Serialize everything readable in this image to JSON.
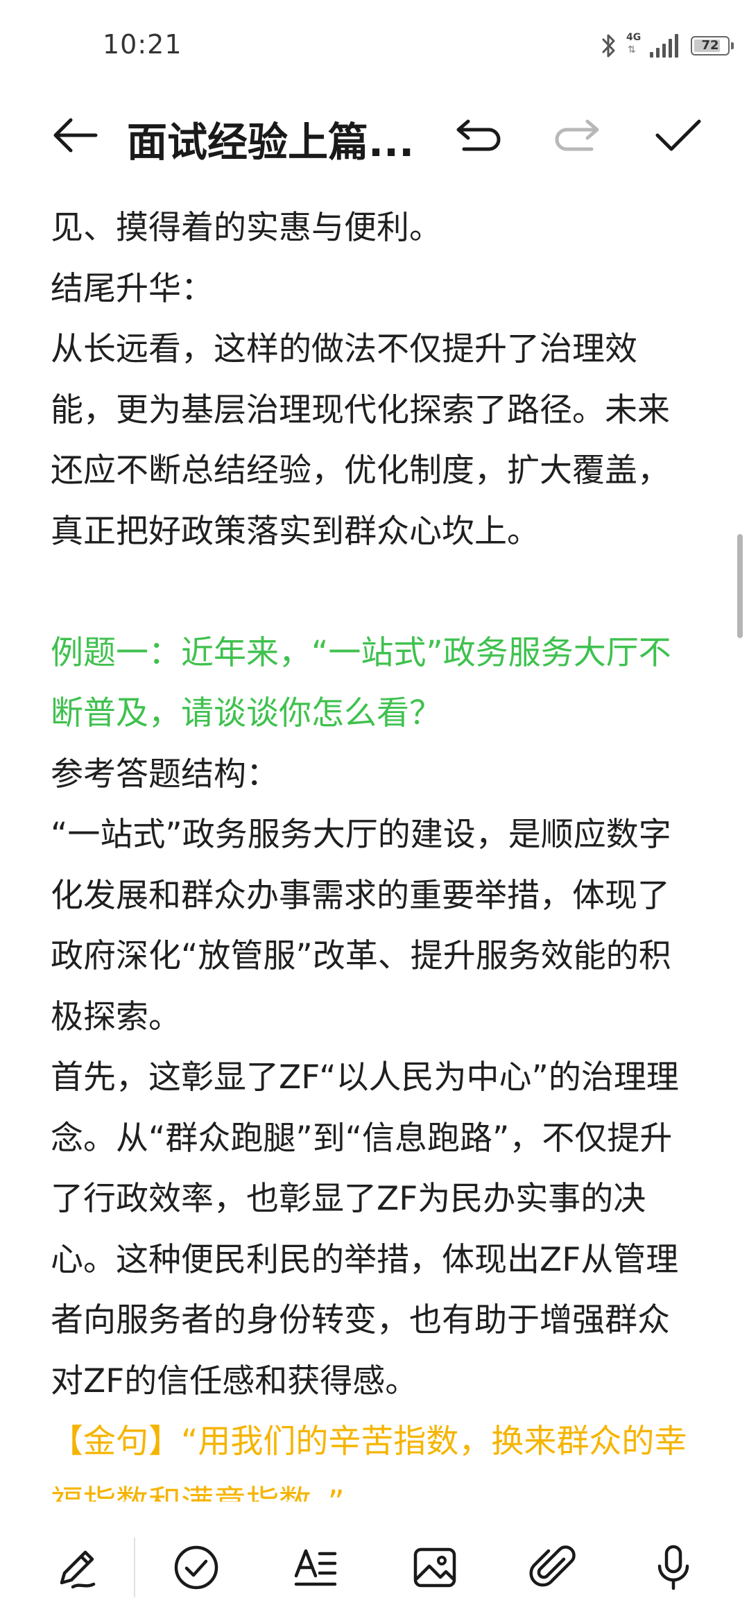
{
  "status_bar": {
    "time": "10:21",
    "network_label": "4G",
    "battery_percent": "72",
    "icons": [
      "bluetooth-icon",
      "network-4g-icon",
      "signal-strength-icon",
      "battery-icon"
    ]
  },
  "toolbar": {
    "title": "面试经验上篇...",
    "icons": [
      "back-arrow-icon",
      "undo-icon",
      "redo-icon",
      "checkmark-icon"
    ]
  },
  "content": {
    "lines": [
      "见、摸得着的实惠与便利。",
      "结尾升华：",
      "从长远看，这样的做法不仅提升了治理效",
      "能，更为基层治理现代化探索了路径。未来",
      "还应不断总结经验，优化制度，扩大覆盖，",
      "真正把好政策落实到群众心坎上。"
    ],
    "example_heading": [
      "例题一：近年来，“一站式”政务服务大厅不",
      "断普及，请谈谈你怎么看？"
    ],
    "answer_lines": [
      "参考答题结构：",
      "“一站式”政务服务大厅的建设，是顺应数字",
      "化发展和群众办事需求的重要举措，体现了",
      "政府深化“放管服”改革、提升服务效能的积",
      "极探索。",
      "首先，这彰显了ZF“以人民为中心”的治理理",
      "念。从“群众跑腿”到“信息跑路”，不仅提升",
      "了行政效率，也彰显了ZF为民办实事的决",
      "心。这种便民利民的举措，体现出ZF从管理",
      "者向服务者的身份转变，也有助于增强群众",
      "对ZF的信任感和获得感。"
    ],
    "golden_quote": [
      "【金句】“用我们的辛苦指数，换来群众的幸",
      "福指数和满意指数。”"
    ]
  },
  "bottom_toolbar": {
    "icons": [
      "pen-icon",
      "checklist-icon",
      "text-format-icon",
      "image-icon",
      "attachment-icon",
      "microphone-icon"
    ]
  },
  "colors": {
    "example_heading": "#3fc14e",
    "golden_quote": "#f5b400",
    "body_text": "#1f1f1f",
    "redo_disabled": "#b8b8b8"
  }
}
